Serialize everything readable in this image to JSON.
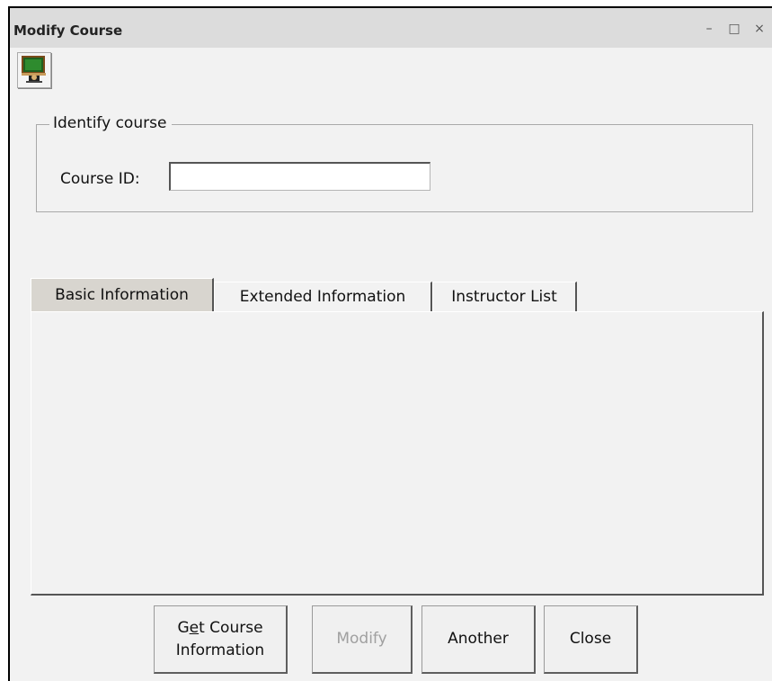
{
  "window": {
    "title": "Modify Course",
    "controls": {
      "minimize": "–",
      "maximize": "□",
      "close": "×"
    }
  },
  "toolbar": {
    "icon": "classroom-board-icon"
  },
  "identify": {
    "legend": "Identify course",
    "course_id_label": "Course ID:",
    "course_id_value": ""
  },
  "tabs": [
    {
      "label": "Basic Information",
      "active": true
    },
    {
      "label": "Extended Information",
      "active": false
    },
    {
      "label": "Instructor List",
      "active": false
    }
  ],
  "buttons": {
    "get_course_line1_pre": "G",
    "get_course_line1_ul": "e",
    "get_course_line1_post": "t Course",
    "get_course_line2": "Information",
    "modify": "Modify",
    "modify_enabled": false,
    "another": "Another",
    "close": "Close"
  },
  "colors": {
    "titlebar": "#dcdcdc",
    "window_bg": "#f2f2f2",
    "active_tab": "#d8d5cf",
    "disabled_text": "#a0a0a0"
  }
}
